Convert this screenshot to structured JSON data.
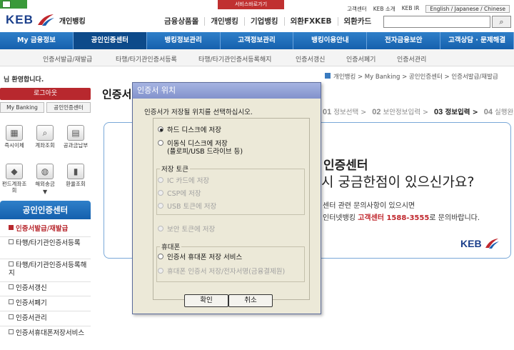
{
  "header": {
    "quick_link": "서비스바로가기",
    "top_links": [
      "고객센터",
      "KEB 소개",
      "KEB IR"
    ],
    "language": "English / Japanese / Chinese",
    "logo_text": "KEB",
    "logo_sub": "개인뱅킹",
    "main_nav": [
      "금융상품몰",
      "개인뱅킹",
      "기업뱅킹",
      "외환FXKEB",
      "외환카드"
    ],
    "search_button": "⌕"
  },
  "menu_bar": [
    "My 금융정보",
    "공인인증센터",
    "뱅킹정보관리",
    "고객정보관리",
    "뱅킹이용안내",
    "전자금융보안",
    "고객상담 · 문제해결"
  ],
  "sub_nav": [
    "인증서발급/재발급",
    "타행/타기관인증서등록",
    "타행/타기관인증서등록해지",
    "인증서갱신",
    "인증서폐기",
    "인증서관리"
  ],
  "sidebar": {
    "welcome": "님 환영합니다.",
    "logout": "로그아웃",
    "my_banking": "My Banking",
    "cert_center": "공인인증센터",
    "quick": [
      {
        "label": "즉시이체",
        "icon": "transfer-icon"
      },
      {
        "label": "계좌조회",
        "icon": "magnifier-icon"
      },
      {
        "label": "공과금납부",
        "icon": "bill-icon"
      },
      {
        "label": "펀드계좌조회",
        "icon": "fund-icon"
      },
      {
        "label": "해외송금",
        "icon": "globe-icon"
      },
      {
        "label": "환율조회",
        "icon": "rate-chart-icon"
      }
    ],
    "section_title": "공인인증센터",
    "menu": [
      "인증서발급/재발급",
      "타행/타기관인증서등록",
      "타행/타기관인증서등록해지",
      "인증서갱신",
      "인증서폐기",
      "인증서관리",
      "인증서휴대폰저장서비스"
    ]
  },
  "breadcrumb": "개인뱅킹 > My Banking > 공인인증센터 > 인증서발급/재발급",
  "page_title": "인증서",
  "steps": [
    {
      "num": "01",
      "label": "정보선택"
    },
    {
      "num": "02",
      "label": "보안정보입력"
    },
    {
      "num": "03",
      "label": "정보입력"
    },
    {
      "num": "04",
      "label": "실행완료"
    }
  ],
  "content": {
    "title": "인증센터",
    "question": "시 궁금한점이 있으신가요?",
    "line1": "센터 관련 문의사항이 있으시면",
    "line2_prefix": "인터넷뱅킹",
    "line2_red": "고객센터 1588-3555",
    "line2_suffix": "로 문의바랍니다.",
    "logo": "KEB"
  },
  "dialog": {
    "title": "인증서 위치",
    "prompt": "인증서가 저장될 위치를 선택하십시오.",
    "hard_disk": "하드 디스크에 저장",
    "removable_1": "이동식 디스크에 저장",
    "removable_2": "(플로피/USB 드라이브 등)",
    "token_group": "저장 토큰",
    "ic_card": "IC 카드에 저장",
    "csp": "CSP에 저장",
    "usb_token": "USB 토큰에 저장",
    "security_token": "보안 토큰에 저장",
    "phone_group": "휴대폰",
    "phone_service": "인증서 휴대폰 저장 서비스",
    "phone_sign": "휴대폰 인증서 저장/전자서명(금융결제원)",
    "ok": "확인",
    "cancel": "취소"
  }
}
